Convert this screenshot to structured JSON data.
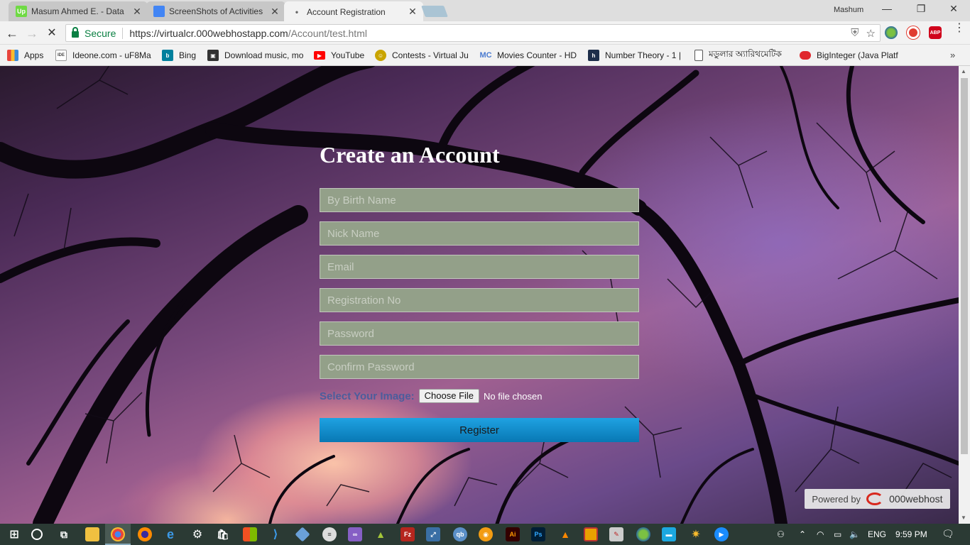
{
  "tabs": [
    {
      "title": "Masum Ahmed E. - Data",
      "favicon": "upwork-icon",
      "color": "#6fda44",
      "glyph": "Up",
      "active": false
    },
    {
      "title": "ScreenShots of Activities",
      "favicon": "docs-icon",
      "color": "#4285f4",
      "glyph": "",
      "active": false
    },
    {
      "title": "Account Registration",
      "favicon": "loading-icon",
      "color": "#999999",
      "glyph": "",
      "active": true
    }
  ],
  "profile_name": "Mashum",
  "address": {
    "secure_label": "Secure",
    "url_host": "https://virtualcr.000webhostapp.com",
    "url_path": "/Account/test.html"
  },
  "bookmarks": [
    {
      "label": "Apps",
      "icon": "apps-grid-icon",
      "color": "#e8453c"
    },
    {
      "label": "Ideone.com - uF8Ma",
      "icon": "ideone-icon",
      "color": "#555555"
    },
    {
      "label": "Bing",
      "icon": "bing-icon",
      "color": "#00809d"
    },
    {
      "label": "Download music, mo",
      "icon": "download-icon",
      "color": "#333333"
    },
    {
      "label": "YouTube",
      "icon": "youtube-icon",
      "color": "#ff0000"
    },
    {
      "label": "Contests - Virtual Ju",
      "icon": "vjudge-icon",
      "color": "#c9a400"
    },
    {
      "label": "Movies Counter - HD",
      "icon": "mc-icon",
      "color": "#4a7bd0"
    },
    {
      "label": "Number Theory - 1 |",
      "icon": "hackerrank-icon",
      "color": "#1d2e4a"
    },
    {
      "label": "মডুলার অ্যারিথমেটিক",
      "icon": "page-icon",
      "color": "#ffffff"
    },
    {
      "label": "BigInteger (Java Platf",
      "icon": "oracle-icon",
      "color": "#e0282e"
    }
  ],
  "form": {
    "title": "Create an Account",
    "placeholders": {
      "birth_name": "By Birth Name",
      "nick_name": "Nick Name",
      "email": "Email",
      "registration_no": "Registration No",
      "password": "Password",
      "confirm_password": "Confirm Password"
    },
    "image_label": "Select Your Image:",
    "choose_file": "Choose File",
    "file_status": "No file chosen",
    "register": "Register"
  },
  "footer": {
    "powered_by": "Powered by",
    "brand": "000webhost"
  },
  "taskbar": {
    "language": "ENG",
    "time": "9:59 PM"
  }
}
